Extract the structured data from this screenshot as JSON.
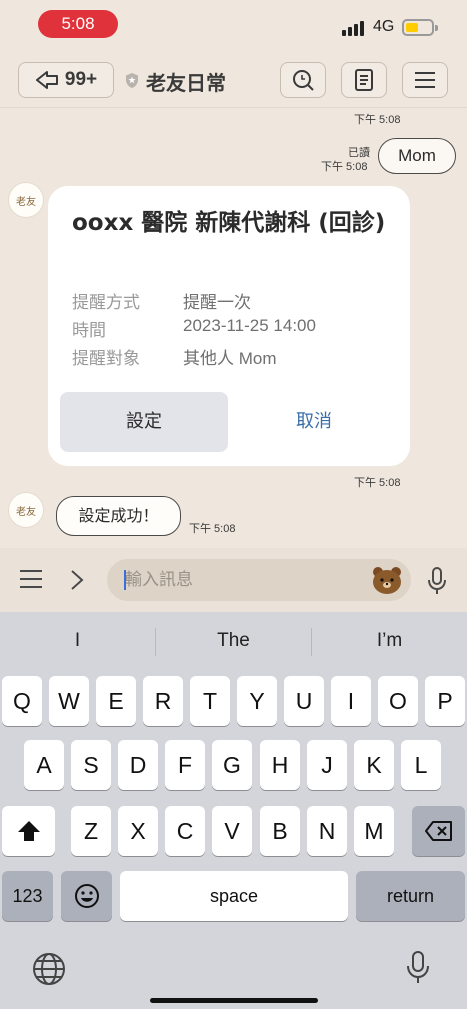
{
  "status_bar": {
    "time": "5:08",
    "network": "4G",
    "battery_color": "#ffcc00"
  },
  "header": {
    "back_count": "99+",
    "title": "老友日常"
  },
  "chat": {
    "timestamps": [
      "下午 5:08",
      "下午 5:08",
      "下午 5:08",
      "下午 5:08"
    ],
    "read_label": "已讀",
    "outgoing_message": "Mom",
    "card": {
      "title": "ooxx 醫院 新陳代謝科 (回診)",
      "rows": [
        {
          "label": "提醒方式",
          "value": "提醒一次"
        },
        {
          "label": "時間",
          "value": "2023-11-25 14:00"
        },
        {
          "label": "提醒對象",
          "value": "其他人 Mom"
        }
      ],
      "confirm_label": "設定",
      "cancel_label": "取消"
    },
    "incoming_message": "設定成功！",
    "avatar_text": "老友"
  },
  "input_bar": {
    "placeholder": "輸入訊息"
  },
  "keyboard": {
    "suggestions": [
      "I",
      "The",
      "I’m"
    ],
    "row1": [
      "Q",
      "W",
      "E",
      "R",
      "T",
      "Y",
      "U",
      "I",
      "O",
      "P"
    ],
    "row2": [
      "A",
      "S",
      "D",
      "F",
      "G",
      "H",
      "J",
      "K",
      "L"
    ],
    "row3": [
      "Z",
      "X",
      "C",
      "V",
      "B",
      "N",
      "M"
    ],
    "numbers_label": "123",
    "space_label": "space",
    "return_label": "return"
  },
  "colors": {
    "accent_time": "#e0323a",
    "link": "#3a6fa8",
    "background": "#efe7dd"
  }
}
